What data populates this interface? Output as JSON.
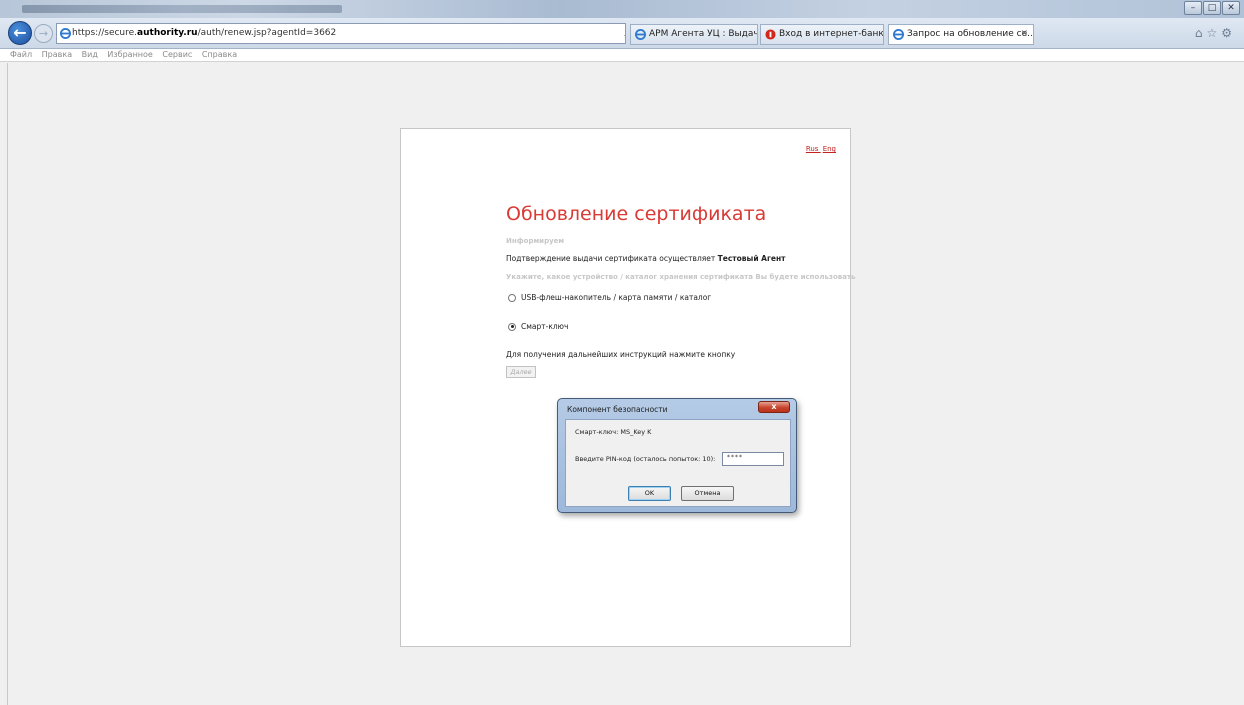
{
  "browser": {
    "url_prefix": "https://secure.",
    "url_host": "authority.ru",
    "url_path": "/auth/renew.jsp?agentId=3662",
    "address_tools": "⌕ ▾ 🔒 ↻",
    "tabs": [
      {
        "label": "АРМ Агента УЦ : Выдача серт...",
        "active": false
      },
      {
        "label": "Вход в интернет-банк",
        "active": false
      },
      {
        "label": "Запрос на обновление се...",
        "active": true
      }
    ],
    "menu": [
      "Файл",
      "Правка",
      "Вид",
      "Избранное",
      "Сервис",
      "Справка"
    ]
  },
  "page": {
    "lang_rus": "Rus",
    "lang_eng": "Eng",
    "title": "Обновление сертификата",
    "info_heading": "Информируем",
    "confirm_prefix": "Подтверждение выдачи сертификата осуществляет ",
    "confirm_agent": "Тестовый Агент",
    "device_prompt": "Укажите, какое устройство / каталог хранения сертификата Вы будете использовать",
    "option_usb": "USB-флеш-накопитель / карта памяти / каталог",
    "option_smartkey": "Смарт-ключ",
    "selected_option": "smartkey",
    "instructions": "Для получения дальнейших инструкций нажмите кнопку",
    "next_label": "Далее"
  },
  "dialog": {
    "title": "Компонент безопасности",
    "close_label": "x",
    "key_label": "Смарт-ключ: MS_Key K",
    "pin_label": "Введите PIN-код (осталось попыток: 10):",
    "pin_value": "****",
    "ok_label": "OK",
    "cancel_label": "Отмена"
  }
}
